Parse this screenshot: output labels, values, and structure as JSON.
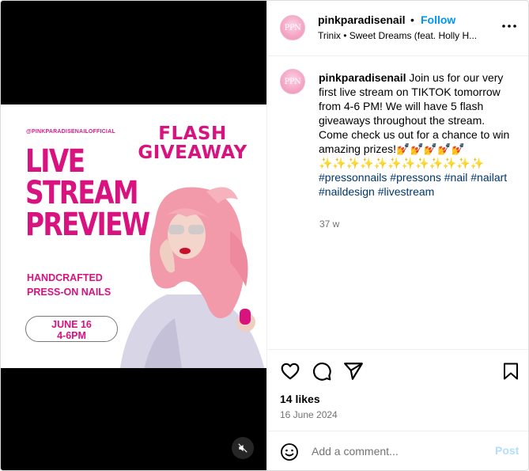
{
  "post": {
    "poster": {
      "handle": "@PINKPARADISENAILOFFICIAL",
      "flash_line1": "FLASH",
      "flash_line2": "GIVEAWAY",
      "title_line1": "LIVE",
      "title_line2": "STREAM",
      "title_line3": "PREVIEW",
      "sub_line1": "HANDCRAFTED",
      "sub_line2": "PRESS-ON NAILS",
      "date_line1": "JUNE 16",
      "date_line2": "4-6PM"
    },
    "mute_icon": "speaker-muted-icon"
  },
  "header": {
    "avatar_text": "PPN",
    "username": "pinkparadisenail",
    "separator": "•",
    "follow_label": "Follow",
    "audio": "Trinix • Sweet Dreams (feat. Holly H...",
    "more_icon": "more-horizontal-icon"
  },
  "caption": {
    "avatar_text": "PPN",
    "username": "pinkparadisenail",
    "text": "Join us for our very first live stream on TIKTOK tomorrow from 4-6 PM! We will have 5 flash giveaways throughout the stream. Come check us out for a chance to win amazing prizes!💅💅💅💅💅",
    "sparkles": "✨✨✨✨✨✨✨✨✨✨✨✨",
    "hashtags": [
      "#pressonnails",
      "#pressons",
      "#nail",
      "#nailart",
      "#naildesign",
      "#livestream"
    ],
    "time_ago": "37 w"
  },
  "actions": {
    "like_icon": "heart-icon",
    "comment_icon": "comment-icon",
    "share_icon": "share-icon",
    "save_icon": "bookmark-icon",
    "likes": "14 likes",
    "date": "16 June 2024"
  },
  "comment_bar": {
    "emoji_icon": "emoji-icon",
    "placeholder": "Add a comment...",
    "post_label": "Post",
    "post_color": "#b2dffc"
  },
  "colors": {
    "brand_pink": "#d8127f",
    "link_blue": "#0095f6",
    "hashtag": "#00376b"
  }
}
